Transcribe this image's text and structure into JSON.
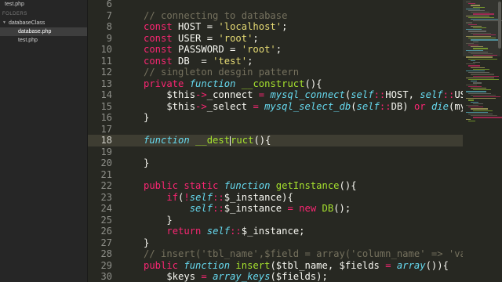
{
  "sidebar": {
    "open_file": "test.php",
    "folders_header": "FOLDERS",
    "folder": "databaseClass",
    "files": [
      "database.php",
      "test.php"
    ]
  },
  "editor": {
    "current_line": "18",
    "lines": [
      {
        "n": "6",
        "tokens": []
      },
      {
        "n": "7",
        "tokens": [
          {
            "c": "cm",
            "t": "// connecting to database"
          }
        ]
      },
      {
        "n": "8",
        "tokens": [
          {
            "c": "kw",
            "t": "const"
          },
          {
            "c": "pl",
            "t": " HOST = "
          },
          {
            "c": "st",
            "t": "'localhost'"
          },
          {
            "c": "pl",
            "t": ";"
          }
        ]
      },
      {
        "n": "9",
        "tokens": [
          {
            "c": "kw",
            "t": "const"
          },
          {
            "c": "pl",
            "t": " USER = "
          },
          {
            "c": "st",
            "t": "'root'"
          },
          {
            "c": "pl",
            "t": ";"
          }
        ]
      },
      {
        "n": "10",
        "tokens": [
          {
            "c": "kw",
            "t": "const"
          },
          {
            "c": "pl",
            "t": " PASSWORD = "
          },
          {
            "c": "st",
            "t": "'root'"
          },
          {
            "c": "pl",
            "t": ";"
          }
        ]
      },
      {
        "n": "11",
        "tokens": [
          {
            "c": "kw",
            "t": "const"
          },
          {
            "c": "pl",
            "t": " DB  = "
          },
          {
            "c": "st",
            "t": "'test'"
          },
          {
            "c": "pl",
            "t": ";"
          }
        ]
      },
      {
        "n": "12",
        "tokens": [
          {
            "c": "cm",
            "t": "// singleton desgin pattern"
          }
        ]
      },
      {
        "n": "13",
        "tokens": [
          {
            "c": "kw",
            "t": "private"
          },
          {
            "c": "pl",
            "t": " "
          },
          {
            "c": "it",
            "t": "function"
          },
          {
            "c": "pl",
            "t": " "
          },
          {
            "c": "fn",
            "t": "__construct"
          },
          {
            "c": "pl",
            "t": "(){"
          }
        ]
      },
      {
        "n": "14",
        "tokens": [
          {
            "c": "pl",
            "t": "    $this"
          },
          {
            "c": "kw",
            "t": "->"
          },
          {
            "c": "pl",
            "t": "_connect "
          },
          {
            "c": "kw",
            "t": "="
          },
          {
            "c": "pl",
            "t": " "
          },
          {
            "c": "it",
            "t": "mysql_connect"
          },
          {
            "c": "pl",
            "t": "("
          },
          {
            "c": "it",
            "t": "self"
          },
          {
            "c": "kw",
            "t": "::"
          },
          {
            "c": "pl",
            "t": "HOST, "
          },
          {
            "c": "it",
            "t": "self"
          },
          {
            "c": "kw",
            "t": "::"
          },
          {
            "c": "pl",
            "t": "USER,"
          }
        ]
      },
      {
        "n": "15",
        "tokens": [
          {
            "c": "pl",
            "t": "    $this"
          },
          {
            "c": "kw",
            "t": "->"
          },
          {
            "c": "pl",
            "t": "_select "
          },
          {
            "c": "kw",
            "t": "="
          },
          {
            "c": "pl",
            "t": " "
          },
          {
            "c": "it",
            "t": "mysql_select_db"
          },
          {
            "c": "pl",
            "t": "("
          },
          {
            "c": "it",
            "t": "self"
          },
          {
            "c": "kw",
            "t": "::"
          },
          {
            "c": "pl",
            "t": "DB) "
          },
          {
            "c": "kw",
            "t": "or"
          },
          {
            "c": "pl",
            "t": " "
          },
          {
            "c": "it",
            "t": "die"
          },
          {
            "c": "pl",
            "t": "(mysql_"
          }
        ]
      },
      {
        "n": "16",
        "tokens": [
          {
            "c": "pl",
            "t": "}"
          }
        ]
      },
      {
        "n": "17",
        "tokens": []
      },
      {
        "n": "18",
        "tokens": [
          {
            "c": "it",
            "t": "function"
          },
          {
            "c": "pl",
            "t": " "
          },
          {
            "c": "fn",
            "t": "__dest"
          },
          {
            "c": "caret",
            "t": ""
          },
          {
            "c": "fn",
            "t": "ruct"
          },
          {
            "c": "pl",
            "t": "(){"
          }
        ]
      },
      {
        "n": "19",
        "tokens": []
      },
      {
        "n": "20",
        "tokens": [
          {
            "c": "pl",
            "t": "}"
          }
        ]
      },
      {
        "n": "21",
        "tokens": []
      },
      {
        "n": "22",
        "tokens": [
          {
            "c": "kw",
            "t": "public"
          },
          {
            "c": "pl",
            "t": " "
          },
          {
            "c": "kw",
            "t": "static"
          },
          {
            "c": "pl",
            "t": " "
          },
          {
            "c": "it",
            "t": "function"
          },
          {
            "c": "pl",
            "t": " "
          },
          {
            "c": "fn",
            "t": "getInstance"
          },
          {
            "c": "pl",
            "t": "(){"
          }
        ]
      },
      {
        "n": "23",
        "tokens": [
          {
            "c": "pl",
            "t": "    "
          },
          {
            "c": "kw",
            "t": "if"
          },
          {
            "c": "pl",
            "t": "("
          },
          {
            "c": "kw",
            "t": "!"
          },
          {
            "c": "it",
            "t": "self"
          },
          {
            "c": "kw",
            "t": "::"
          },
          {
            "c": "pl",
            "t": "$_instance){"
          }
        ]
      },
      {
        "n": "24",
        "tokens": [
          {
            "c": "pl",
            "t": "        "
          },
          {
            "c": "it",
            "t": "self"
          },
          {
            "c": "kw",
            "t": "::"
          },
          {
            "c": "pl",
            "t": "$_instance "
          },
          {
            "c": "kw",
            "t": "="
          },
          {
            "c": "pl",
            "t": " "
          },
          {
            "c": "kw",
            "t": "new"
          },
          {
            "c": "pl",
            "t": " "
          },
          {
            "c": "fn",
            "t": "DB"
          },
          {
            "c": "pl",
            "t": "();"
          }
        ]
      },
      {
        "n": "25",
        "tokens": [
          {
            "c": "pl",
            "t": "    }"
          }
        ]
      },
      {
        "n": "26",
        "tokens": [
          {
            "c": "pl",
            "t": "    "
          },
          {
            "c": "kw",
            "t": "return"
          },
          {
            "c": "pl",
            "t": " "
          },
          {
            "c": "it",
            "t": "self"
          },
          {
            "c": "kw",
            "t": "::"
          },
          {
            "c": "pl",
            "t": "$_instance;"
          }
        ]
      },
      {
        "n": "27",
        "tokens": [
          {
            "c": "pl",
            "t": "}"
          }
        ]
      },
      {
        "n": "28",
        "tokens": [
          {
            "c": "cm",
            "t": "// insert('tbl_name',$field = array('column_name' => 'value"
          }
        ]
      },
      {
        "n": "29",
        "tokens": [
          {
            "c": "kw",
            "t": "public"
          },
          {
            "c": "pl",
            "t": " "
          },
          {
            "c": "it",
            "t": "function"
          },
          {
            "c": "pl",
            "t": " "
          },
          {
            "c": "fn",
            "t": "insert"
          },
          {
            "c": "pl",
            "t": "($tbl_name, $fields "
          },
          {
            "c": "kw",
            "t": "="
          },
          {
            "c": "pl",
            "t": " "
          },
          {
            "c": "it",
            "t": "array"
          },
          {
            "c": "pl",
            "t": "()){"
          }
        ]
      },
      {
        "n": "30",
        "tokens": [
          {
            "c": "pl",
            "t": "    $keys "
          },
          {
            "c": "kw",
            "t": "="
          },
          {
            "c": "pl",
            "t": " "
          },
          {
            "c": "it",
            "t": "array_keys"
          },
          {
            "c": "pl",
            "t": "($fields);"
          }
        ]
      }
    ]
  },
  "colors": {
    "background": "#272822",
    "comment": "#75715e",
    "keyword": "#f92672",
    "string": "#e6db74",
    "function_name": "#a6e22e",
    "storage": "#66d9ef"
  }
}
